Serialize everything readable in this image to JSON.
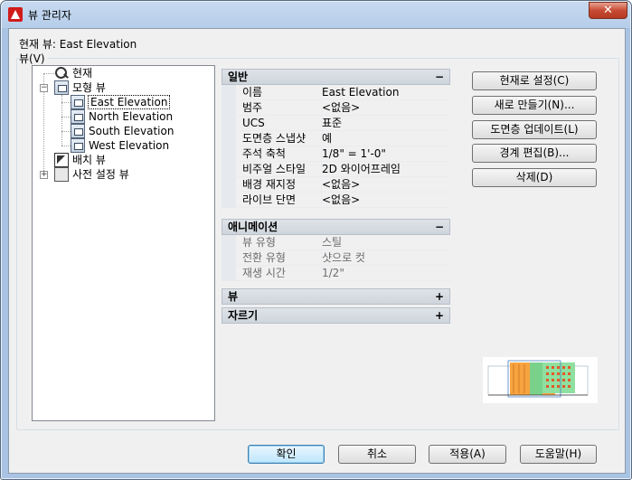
{
  "window": {
    "title": "뷰 관리자",
    "close_label": "✕"
  },
  "current_view_text": "현재 뷰: East Elevation",
  "views_group_label": "뷰(V)",
  "tree": {
    "current": "현재",
    "model_views": "모형 뷰",
    "children": [
      "East Elevation",
      "North Elevation",
      "South Elevation",
      "West Elevation"
    ],
    "layout_views": "배치 뷰",
    "preset_views": "사전 설정 뷰"
  },
  "properties": {
    "general": {
      "header": "일반",
      "toggle": "−",
      "rows": [
        {
          "key": "이름",
          "value": "East Elevation"
        },
        {
          "key": "범주",
          "value": "<없음>"
        },
        {
          "key": "UCS",
          "value": "표준"
        },
        {
          "key": "도면층 스냅샷",
          "value": "예"
        },
        {
          "key": "주석 축척",
          "value": "1/8\" = 1'-0\""
        },
        {
          "key": "비주얼 스타일",
          "value": "2D 와이어프레임"
        },
        {
          "key": "배경 재지정",
          "value": "<없음>"
        },
        {
          "key": "라이브 단면",
          "value": "<없음>"
        }
      ]
    },
    "animation": {
      "header": "애니메이션",
      "toggle": "−",
      "rows": [
        {
          "key": "뷰 유형",
          "value": "스틸"
        },
        {
          "key": "전환 유형",
          "value": "샷으로 컷"
        },
        {
          "key": "재생 시간",
          "value": "1/2\""
        }
      ]
    },
    "view": {
      "header": "뷰",
      "toggle": "+"
    },
    "clipping": {
      "header": "자르기",
      "toggle": "+"
    }
  },
  "side_buttons": {
    "set_current": "현재로 설정(C)",
    "new": "새로 만들기(N)...",
    "update_layers": "도면층 업데이트(L)",
    "edit_boundaries": "경계 편집(B)...",
    "delete": "삭제(D)"
  },
  "bottom_buttons": {
    "ok": "확인",
    "cancel": "취소",
    "apply": "적용(A)",
    "help": "도움말(H)"
  }
}
